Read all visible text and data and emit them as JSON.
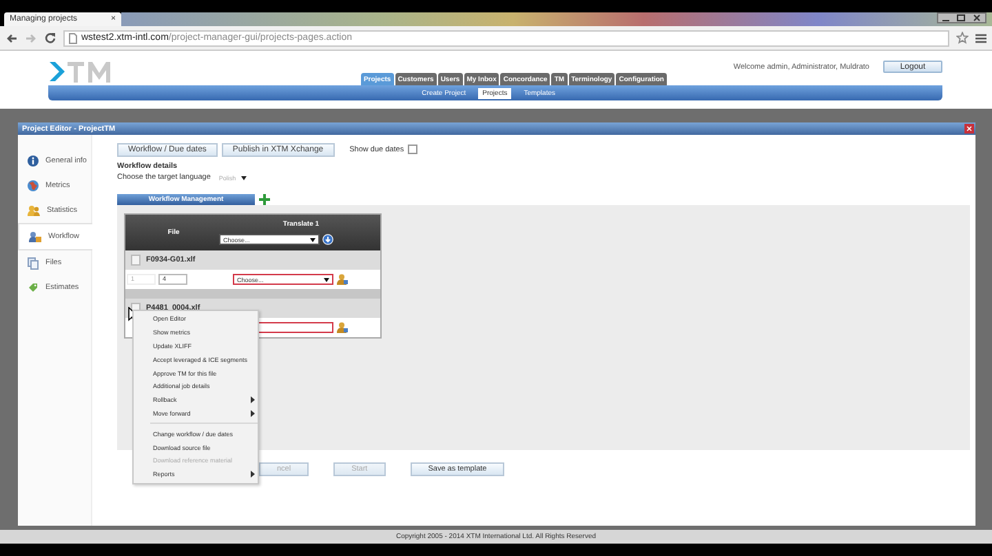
{
  "browser": {
    "tab_title": "Managing projects",
    "tab_close": "×",
    "url_host": "wstest2.xtm-intl.com",
    "url_path": "/project-manager-gui/projects-pages.action"
  },
  "header": {
    "welcome": "Welcome admin, Administrator, Muldrato",
    "logout": "Logout",
    "nav_tabs": [
      {
        "label": "Projects",
        "selected": true
      },
      {
        "label": "Customers",
        "selected": false
      },
      {
        "label": "Users",
        "selected": false
      },
      {
        "label": "My Inbox",
        "selected": false
      },
      {
        "label": "Concordance",
        "selected": false
      },
      {
        "label": "TM",
        "selected": false
      },
      {
        "label": "Terminology",
        "selected": false
      },
      {
        "label": "Configuration",
        "selected": false
      }
    ],
    "sub_tabs": [
      {
        "label": "Create Project",
        "selected": false
      },
      {
        "label": "Projects",
        "selected": true
      },
      {
        "label": "Templates",
        "selected": false
      }
    ]
  },
  "dialog": {
    "title": "Project Editor - ProjectTM",
    "sidebar": [
      {
        "label": "General info",
        "selected": false
      },
      {
        "label": "Metrics",
        "selected": false
      },
      {
        "label": "Statistics",
        "selected": false
      },
      {
        "label": "Workflow",
        "selected": true
      },
      {
        "label": "Files",
        "selected": false
      },
      {
        "label": "Estimates",
        "selected": false
      }
    ],
    "toolbar_buttons": [
      "Workflow / Due dates",
      "Publish in XTM Xchange"
    ],
    "show_due_dates": {
      "label": "Show due dates",
      "checked": false
    },
    "details_heading": "Workflow details",
    "language_label": "Choose the target language",
    "language_value": "Polish",
    "workflow_tab": "Workflow Management",
    "table": {
      "file_header": "File",
      "step_header": "Translate 1",
      "header_select": "Choose...",
      "files": [
        {
          "name": "F0934-G01.xlf",
          "checked": false,
          "from": "1",
          "to": "4",
          "select": "Choose...",
          "invalid": true
        },
        {
          "name": "P4481_0004.xlf",
          "checked": false,
          "invalid": true
        }
      ]
    },
    "context_menu": [
      {
        "kind": "item",
        "label": "Open Editor",
        "submenu": false,
        "disabled": false
      },
      {
        "kind": "item",
        "label": "Show metrics",
        "submenu": false,
        "disabled": false
      },
      {
        "kind": "item",
        "label": "Update XLIFF",
        "submenu": false,
        "disabled": false
      },
      {
        "kind": "item",
        "label": "Accept leveraged & ICE segments",
        "submenu": false,
        "disabled": false
      },
      {
        "kind": "item",
        "label": "Approve TM for this file",
        "submenu": false,
        "disabled": false
      },
      {
        "kind": "item",
        "label": "Additional job details",
        "submenu": false,
        "disabled": false
      },
      {
        "kind": "item",
        "label": "Rollback",
        "submenu": true,
        "disabled": false
      },
      {
        "kind": "item",
        "label": "Move forward",
        "submenu": true,
        "disabled": false
      },
      {
        "kind": "separator"
      },
      {
        "kind": "item",
        "label": "Change workflow / due dates",
        "submenu": false,
        "disabled": false
      },
      {
        "kind": "item",
        "label": "Download source file",
        "submenu": false,
        "disabled": false
      },
      {
        "kind": "item",
        "label": "Download reference material",
        "submenu": false,
        "disabled": true
      },
      {
        "kind": "item",
        "label": "Reports",
        "submenu": true,
        "disabled": false
      }
    ],
    "bottom_buttons": [
      {
        "label": "ncel",
        "disabled": true
      },
      {
        "label": "Start",
        "disabled": true
      },
      {
        "label": "Save as template",
        "disabled": false
      }
    ]
  },
  "footer": "Copyright 2005 - 2014 XTM International Ltd. All Rights Reserved"
}
